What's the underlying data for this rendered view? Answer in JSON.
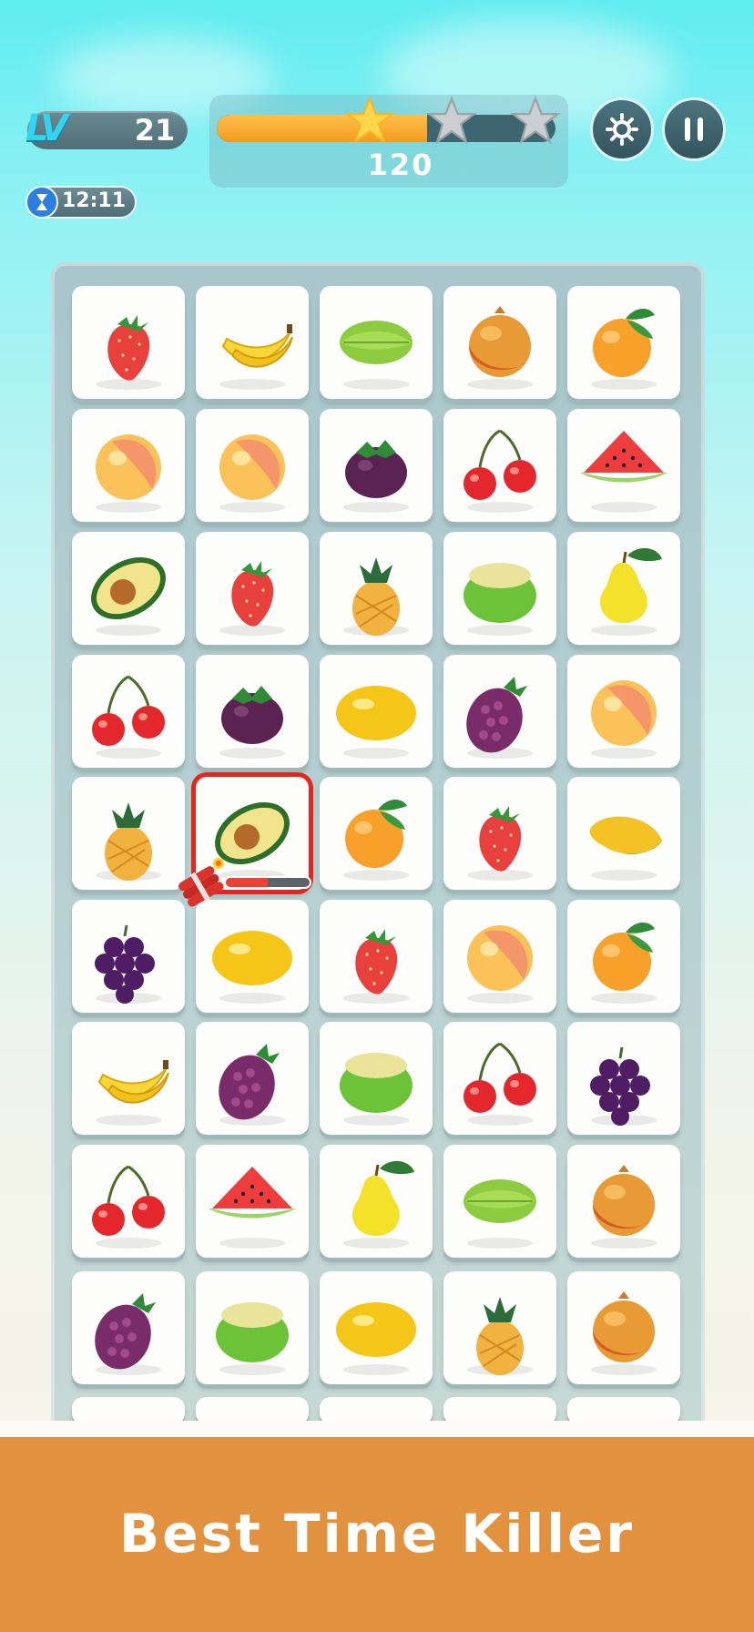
{
  "hud": {
    "level_prefix": "LV",
    "level": "21",
    "timer": "12:11",
    "score": "120",
    "stars_earned": 1,
    "stars_total": 3,
    "progress_fraction": 0.62
  },
  "banner": {
    "text": "Best Time Killer"
  },
  "board": {
    "rows": [
      [
        "strawberry",
        "banana",
        "starfruit",
        "pomegranate",
        "orange"
      ],
      [
        "peach",
        "peach",
        "mangosteen",
        "cherry",
        "watermelon"
      ],
      [
        "avocado",
        "strawberry",
        "pineapple",
        "guava",
        "pear"
      ],
      [
        "cherry",
        "mangosteen",
        "lemon",
        "blackberry",
        "peach"
      ],
      [
        "pineapple",
        "avocado",
        "orange",
        "strawberry",
        "mango"
      ],
      [
        "grape",
        "lemon",
        "strawberry",
        "peach",
        "orange"
      ],
      [
        "banana",
        "blackberry",
        "guava",
        "cherry",
        "grape"
      ],
      [
        "cherry",
        "watermelon",
        "pear",
        "starfruit",
        "pomegranate"
      ],
      [
        "blackberry",
        "guava",
        "lemon",
        "pineapple",
        "pomegranate"
      ]
    ],
    "selected_tile": {
      "row": 4,
      "col": 1,
      "bomb_fuse_fraction": 0.5
    }
  },
  "colors": {
    "accent_orange": "#f39b1f",
    "selected_border": "#e3271f",
    "banner_bg": "#e2913f"
  }
}
